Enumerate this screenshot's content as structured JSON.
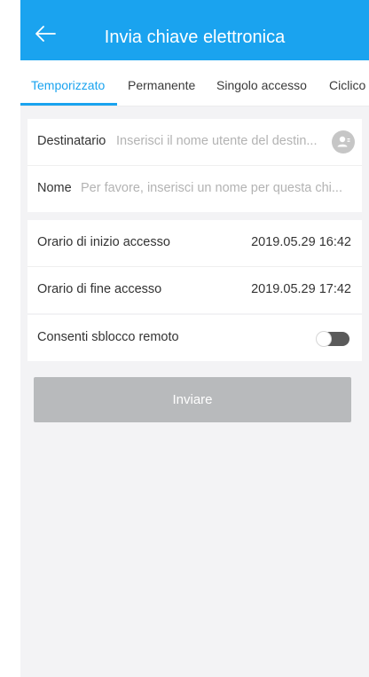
{
  "header": {
    "title": "Invia chiave elettronica",
    "back_icon": "arrow-left-icon"
  },
  "tabs": [
    {
      "label": "Temporizzato",
      "active": true
    },
    {
      "label": "Permanente",
      "active": false
    },
    {
      "label": "Singolo accesso",
      "active": false
    },
    {
      "label": "Ciclico",
      "active": false
    }
  ],
  "recipient": {
    "label": "Destinatario",
    "placeholder": "Inserisci il nome utente del destin...",
    "icon": "contact-icon"
  },
  "name": {
    "label": "Nome",
    "placeholder": "Per favore, inserisci un nome per questa chi..."
  },
  "times": {
    "start_label": "Orario di inizio accesso",
    "start_value": "2019.05.29 16:42",
    "end_label": "Orario di fine accesso",
    "end_value": "2019.05.29 17:42"
  },
  "remote": {
    "label": "Consenti sblocco remoto",
    "enabled": false
  },
  "send_button": {
    "label": "Inviare"
  },
  "colors": {
    "accent": "#1aa3ef",
    "disabled_button": "#b8babc"
  }
}
